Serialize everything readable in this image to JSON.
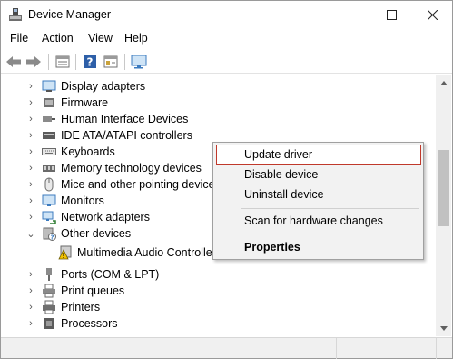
{
  "window": {
    "title": "Device Manager",
    "icons": {
      "app": "device-manager-icon",
      "minimize": "minimize-icon",
      "maximize": "maximize-icon",
      "close": "close-icon"
    }
  },
  "menubar": {
    "items": [
      "File",
      "Action",
      "View",
      "Help"
    ]
  },
  "toolbar": {
    "buttons": [
      "back-arrow-icon",
      "forward-arrow-icon",
      "properties-icon",
      "help-icon",
      "show-hidden-icon",
      "monitor-icon"
    ]
  },
  "tree": {
    "items": [
      {
        "label": "Display adapters",
        "icon": "display-adapter-icon",
        "expanded": false
      },
      {
        "label": "Firmware",
        "icon": "firmware-icon",
        "expanded": false
      },
      {
        "label": "Human Interface Devices",
        "icon": "hid-icon",
        "expanded": false
      },
      {
        "label": "IDE ATA/ATAPI controllers",
        "icon": "ide-controller-icon",
        "expanded": false
      },
      {
        "label": "Keyboards",
        "icon": "keyboard-icon",
        "expanded": false
      },
      {
        "label": "Memory technology devices",
        "icon": "memory-icon",
        "expanded": false
      },
      {
        "label": "Mice and other pointing device",
        "icon": "mouse-icon",
        "expanded": false
      },
      {
        "label": "Monitors",
        "icon": "monitor-icon",
        "expanded": false
      },
      {
        "label": "Network adapters",
        "icon": "network-adapter-icon",
        "expanded": false
      },
      {
        "label": "Other devices",
        "icon": "other-devices-icon",
        "expanded": true
      },
      {
        "label": "Multimedia Audio Controller",
        "icon": "warning-device-icon",
        "child": true
      },
      {
        "label": "Ports (COM & LPT)",
        "icon": "port-icon",
        "expanded": false
      },
      {
        "label": "Print queues",
        "icon": "print-queue-icon",
        "expanded": false
      },
      {
        "label": "Printers",
        "icon": "printer-icon",
        "expanded": false
      },
      {
        "label": "Processors",
        "icon": "processor-icon",
        "expanded": false
      }
    ]
  },
  "context_menu": {
    "items": [
      {
        "label": "Update driver",
        "highlighted": true
      },
      {
        "label": "Disable device"
      },
      {
        "label": "Uninstall device"
      },
      {
        "label": "Scan for hardware changes"
      },
      {
        "label": "Properties",
        "bold": true
      }
    ]
  },
  "colors": {
    "highlight_border": "#c0392b",
    "menu_background": "#f2f2f2",
    "warning": "#f2c200"
  }
}
